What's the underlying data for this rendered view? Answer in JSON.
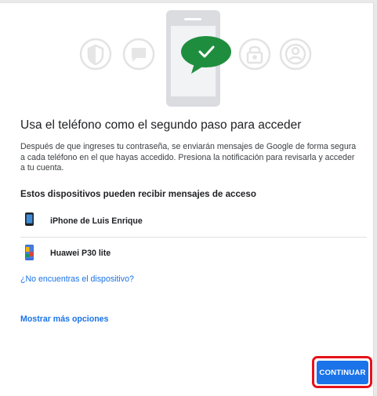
{
  "header": {
    "title": "Usa el teléfono como el segundo paso para acceder",
    "description": "Después de que ingreses tu contraseña, se enviarán mensajes de Google de forma segura a cada teléfono en el que hayas accedido. Presiona la notificación para revisarla y acceder a tu cuenta."
  },
  "devices": {
    "heading": "Estos dispositivos pueden recibir mensajes de acceso",
    "items": [
      {
        "name": "iPhone de Luis Enrique",
        "icon": "iphone-icon"
      },
      {
        "name": "Huawei P30 lite",
        "icon": "android-phone-icon"
      }
    ]
  },
  "links": {
    "not_found": "¿No encuentras el dispositivo?",
    "more_options": "Mostrar más opciones"
  },
  "actions": {
    "continue_label": "CONTINUAR"
  },
  "colors": {
    "accent": "#1a73e8",
    "check_bubble": "#1e8e3e",
    "highlight": "#e6121a"
  }
}
